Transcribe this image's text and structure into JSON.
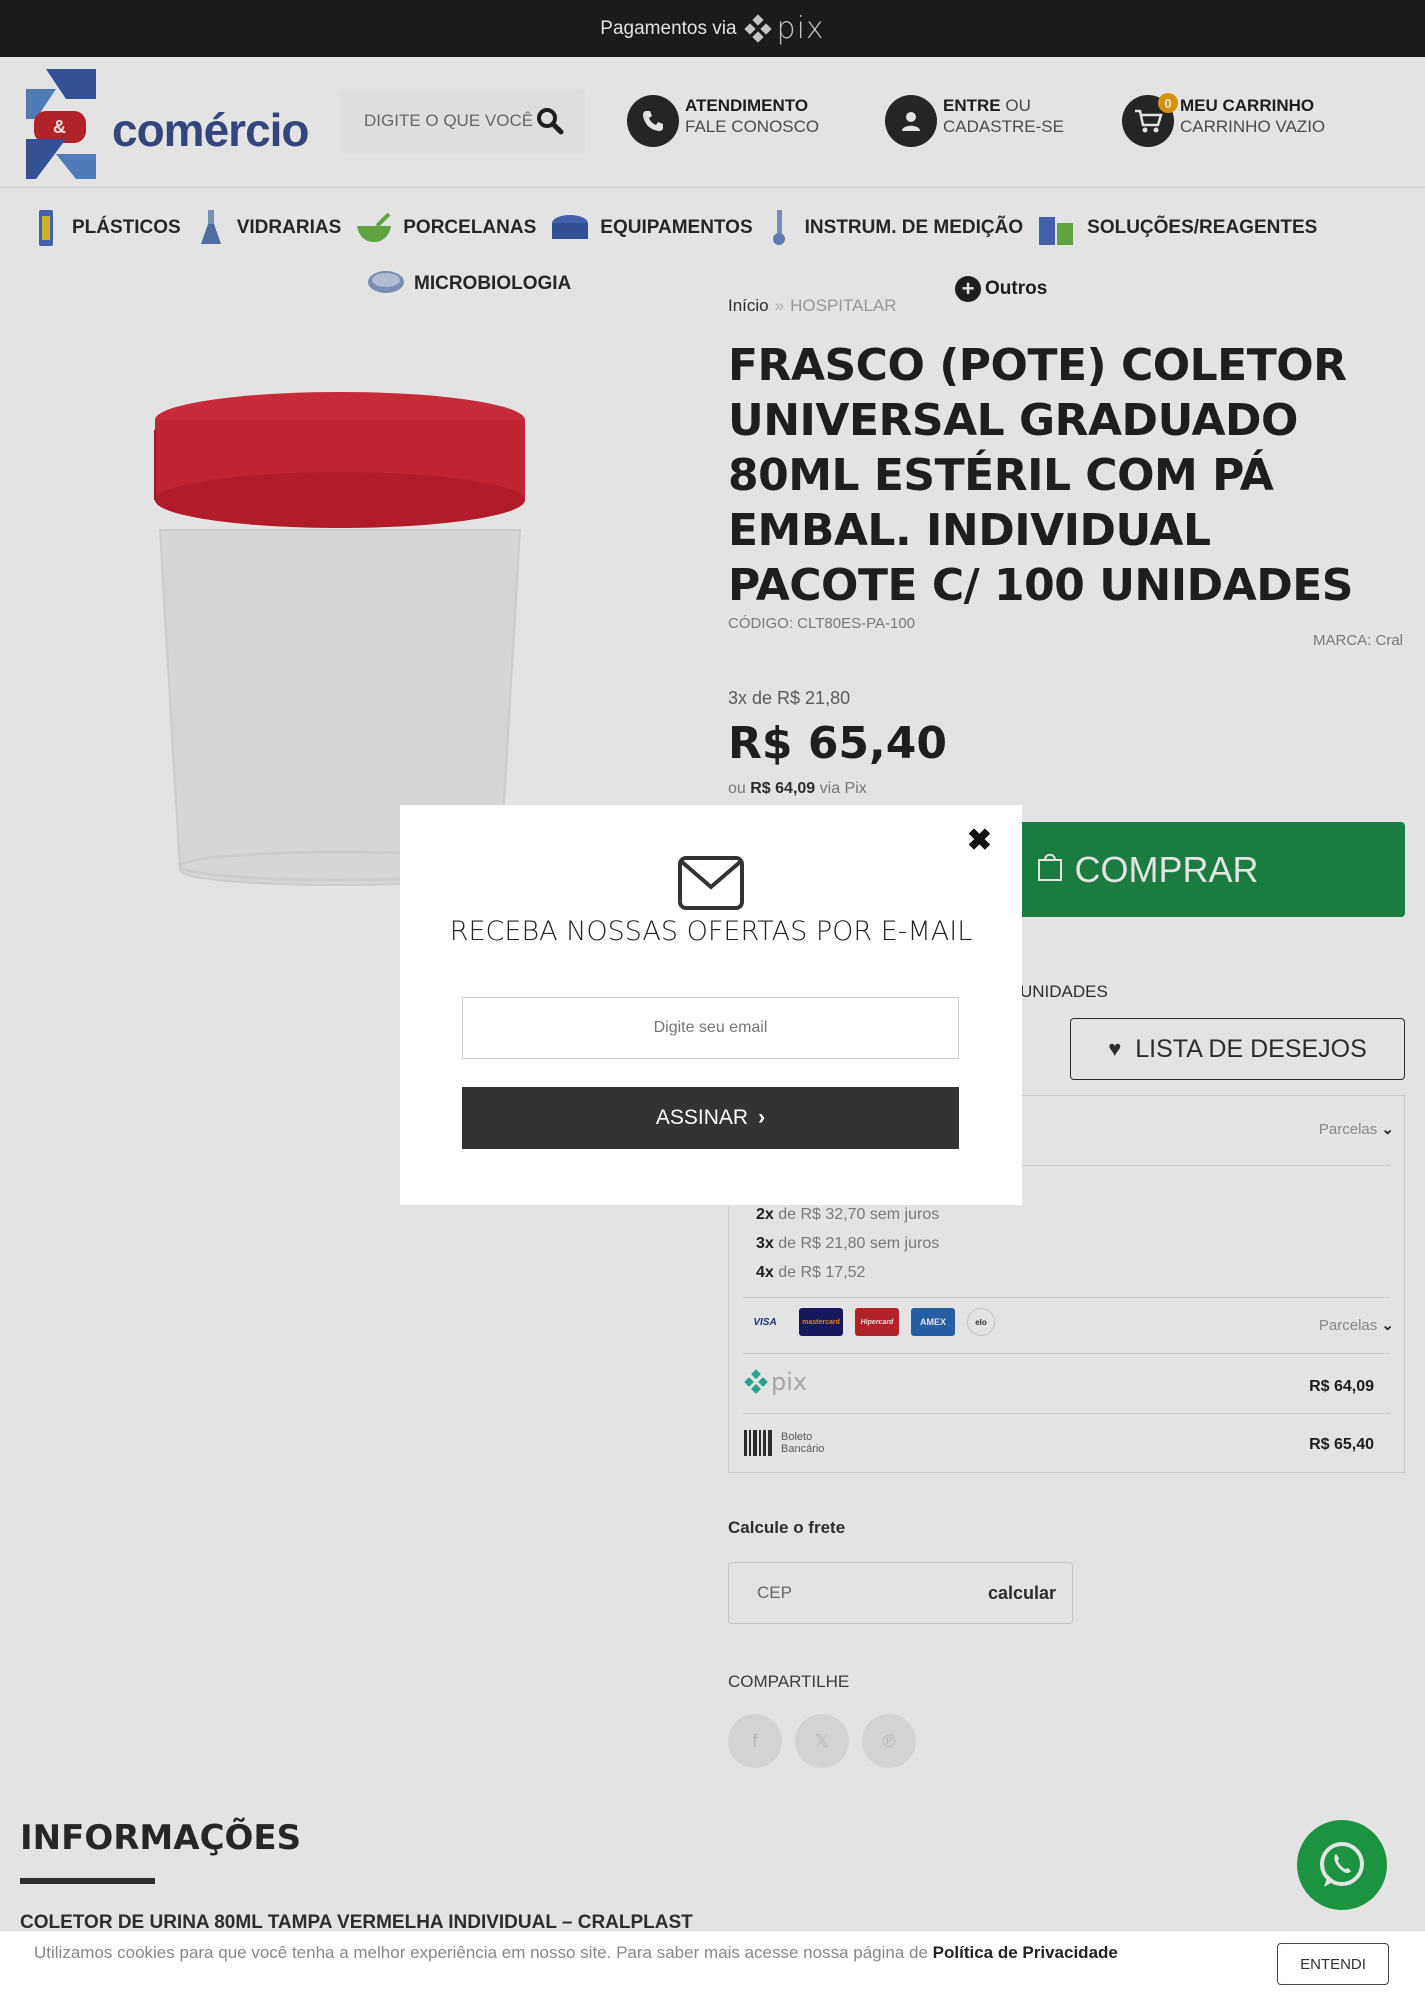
{
  "topbar": {
    "text": "Pagamentos via",
    "pix_word": "pix"
  },
  "header": {
    "logo_text": "comércio",
    "logo_badge": "&",
    "search": {
      "placeholder": "DIGITE O QUE VOCÊ PROCURA"
    },
    "atendimento": {
      "title": "ATENDIMENTO",
      "sub": "FALE CONOSCO"
    },
    "account": {
      "title": "ENTRE",
      "or": "OU",
      "sub": "CADASTRE-SE"
    },
    "cart": {
      "title": "MEU CARRINHO",
      "sub": "CARRINHO VAZIO",
      "count": "0"
    }
  },
  "nav": {
    "items": [
      {
        "label": "PLÁSTICOS",
        "icon": "plastic-tube-icon"
      },
      {
        "label": "VIDRARIAS",
        "icon": "flask-icon"
      },
      {
        "label": "PORCELANAS",
        "icon": "mortar-icon"
      },
      {
        "label": "EQUIPAMENTOS",
        "icon": "equipment-icon"
      },
      {
        "label": "INSTRUM. DE MEDIÇÃO",
        "icon": "thermometer-icon"
      },
      {
        "label": "SOLUÇÕES/REAGENTES",
        "icon": "reagent-bottles-icon"
      }
    ],
    "second": {
      "label": "MICROBIOLOGIA",
      "icon": "petri-dish-icon"
    },
    "outros": "Outros"
  },
  "breadcrumb": {
    "home": "Início",
    "current": "HOSPITALAR"
  },
  "product": {
    "title": "FRASCO (POTE) COLETOR UNIVERSAL GRADUADO 80ML ESTÉRIL COM PÁ EMBAL. INDIVIDUAL PACOTE C/ 100 UNIDADES",
    "codigo": "CÓDIGO: CLT80ES-PA-100",
    "marca": "MARCA: Cral",
    "installments": "3x de R$ 21,80",
    "price": "R$ 65,40",
    "pix_prefix": "ou",
    "pix_price": "R$ 64,09",
    "pix_suffix": "via Pix",
    "buy_label": "COMPRAR",
    "units_text": "UNIDADES",
    "wishlist_label": "LISTA DE DESEJOS",
    "accent_color": "#1f8c4b"
  },
  "payments": {
    "parcelas_label": "Parcelas",
    "lines": [
      {
        "n": "2x",
        "text": "de R$ 32,70 sem juros"
      },
      {
        "n": "3x",
        "text": "de R$ 21,80 sem juros"
      },
      {
        "n": "4x",
        "text": "de R$ 17,52"
      }
    ],
    "cards": [
      "VISA",
      "mastercard",
      "Hipercard",
      "AMEX",
      "elo"
    ],
    "pix_value": "R$ 64,09",
    "boleto_label_1": "Boleto",
    "boleto_label_2": "Bancário",
    "boleto_value": "R$ 65,40"
  },
  "shipping": {
    "title": "Calcule o frete",
    "placeholder": "CEP",
    "button": "calcular"
  },
  "share": {
    "title": "COMPARTILHE",
    "facebook": "f",
    "x": "𝕏",
    "pinterest": "℗"
  },
  "info": {
    "title": "INFORMAÇÕES",
    "desc": "COLETOR DE URINA 80ML TAMPA VERMELHA INDIVIDUAL – CRALPLAST"
  },
  "modal": {
    "title": "RECEBA NOSSAS OFERTAS POR E-MAIL",
    "email_placeholder": "Digite seu email",
    "subscribe": "ASSINAR",
    "close": "✖"
  },
  "cookie": {
    "text": "Utilizamos cookies para que você tenha a melhor experiência em nosso site. Para saber mais acesse nossa página de",
    "link": "Política de Privacidade",
    "button": "ENTENDI"
  }
}
